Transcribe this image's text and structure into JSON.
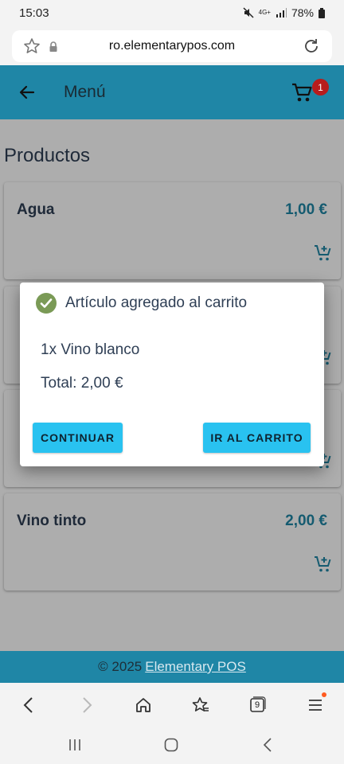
{
  "status_bar": {
    "time": "15:03",
    "network": "4G+",
    "battery": "78%"
  },
  "browser": {
    "url": "ro.elementarypos.com",
    "tabs_count": "9"
  },
  "app_bar": {
    "title": "Menú",
    "cart_count": "1"
  },
  "page": {
    "section_title": "Productos",
    "products": [
      {
        "name": "Agua",
        "price": "1,00 €"
      },
      {
        "name": "",
        "price": ""
      },
      {
        "name": "",
        "price": ""
      },
      {
        "name": "Vino tinto",
        "price": "2,00 €"
      }
    ]
  },
  "dialog": {
    "title": "Artículo agregado al carrito",
    "item": "1x Vino blanco",
    "total": "Total: 2,00 €",
    "continue_label": "CONTINUAR",
    "go_to_cart_label": "IR AL CARRITO"
  },
  "footer": {
    "copyright": "© 2025",
    "link_text": "Elementary POS"
  },
  "colors": {
    "brand": "#1f86a6",
    "button": "#29c2f0",
    "badge": "#b71c1c",
    "check": "#7a9a56"
  },
  "icons": {
    "back": "arrow-left-icon",
    "cart": "shopping-cart-icon",
    "add_to_cart": "cart-plus-icon",
    "success": "check-circle-icon"
  }
}
